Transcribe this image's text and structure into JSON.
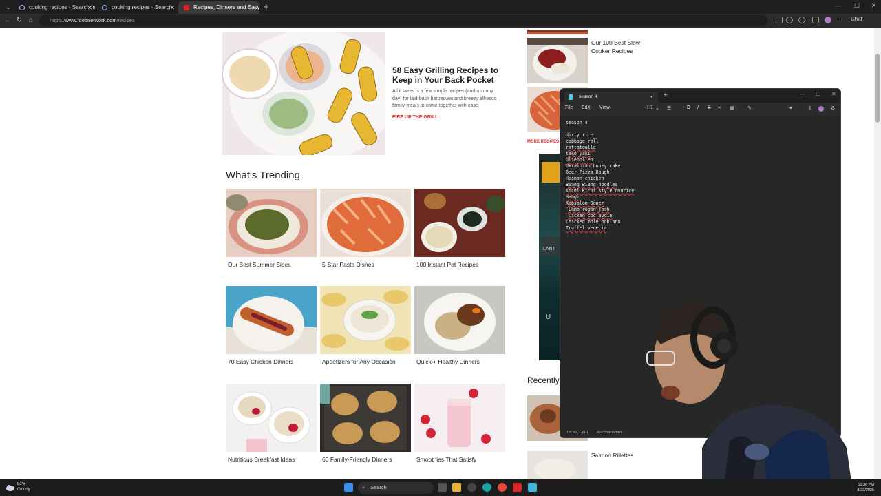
{
  "browser": {
    "tabs": [
      {
        "label": "cooking recipes - Search Images",
        "active": false
      },
      {
        "label": "cooking recipes - Search",
        "active": false
      },
      {
        "label": "Recipes, Dinners and Easy Meal Id",
        "active": true
      }
    ],
    "url_prefix": "https://",
    "url_host": "www.foodnetwork.com",
    "url_path": "/recipes",
    "chat_label": "Chat"
  },
  "hero": {
    "title": "58 Easy Grilling Recipes to Keep in Your Back Pocket",
    "description": "All it takes is a few simple recipes (and a sunny day) for laid-back barbecues and breezy alfresco family meals to come together with ease.",
    "cta": "FIRE UP THE GRILL"
  },
  "trending": {
    "heading": "What's Trending",
    "cards": [
      {
        "caption": "Our Best Summer Sides"
      },
      {
        "caption": "5-Star Pasta Dishes"
      },
      {
        "caption": "100 Instant Pot Recipes"
      },
      {
        "caption": "70 Easy Chicken Dinners"
      },
      {
        "caption": "Appetizers for Any Occasion"
      },
      {
        "caption": "Quick + Healthy Dinners"
      },
      {
        "caption": "Nutritious Breakfast Ideas"
      },
      {
        "caption": "60 Family-Friendly Dinners"
      },
      {
        "caption": "Smoothies That Satisfy"
      }
    ]
  },
  "sidebar": {
    "item1_line1": "Our 100 Best Slow",
    "item1_line2": "Cooker Recipes",
    "more_recipes": "MORE RECIPES",
    "recently_heading": "Recently",
    "salmon_label": "Salmon Rillettes"
  },
  "notepad": {
    "tab_title": "season 4",
    "menu": [
      "File",
      "Edit",
      "View"
    ],
    "heading_style": "H1",
    "lines": [
      {
        "text": "season 4",
        "spell": false
      },
      {
        "text": "",
        "spell": false
      },
      {
        "text": "dirty rice",
        "spell": false
      },
      {
        "text": "cabbage roll",
        "spell": false
      },
      {
        "text": "rattatoulle",
        "spell": true
      },
      {
        "text": "tako yaki",
        "spell": true
      },
      {
        "text": "Oliebollen",
        "spell": true
      },
      {
        "text": "Ukrainian honey cake",
        "spell": false
      },
      {
        "text": "Beer Pizza Dough",
        "spell": false
      },
      {
        "text": "Hainan chicken",
        "spell": false
      },
      {
        "text": "Biang Biang noodles",
        "spell": true
      },
      {
        "text": "Kichi Kichi style omurice",
        "spell": true
      },
      {
        "text": "Hangi",
        "spell": true
      },
      {
        "text": "Kapsalon Döner",
        "spell": true
      },
      {
        "text": " Lamb rogan josh",
        "spell": true
      },
      {
        "text": " Cicken coc avoin",
        "spell": true
      },
      {
        "text": "Chicken mole poblano",
        "spell": false
      },
      {
        "text": "Truffel venecia",
        "spell": true
      }
    ],
    "status_position": "Ln 20, Col 1",
    "status_chars": "260 characters"
  },
  "taskbar": {
    "temperature": "82°F",
    "condition": "Cloudy",
    "search_label": "Search",
    "time": "10:36 PM",
    "date": "8/22/2025"
  }
}
